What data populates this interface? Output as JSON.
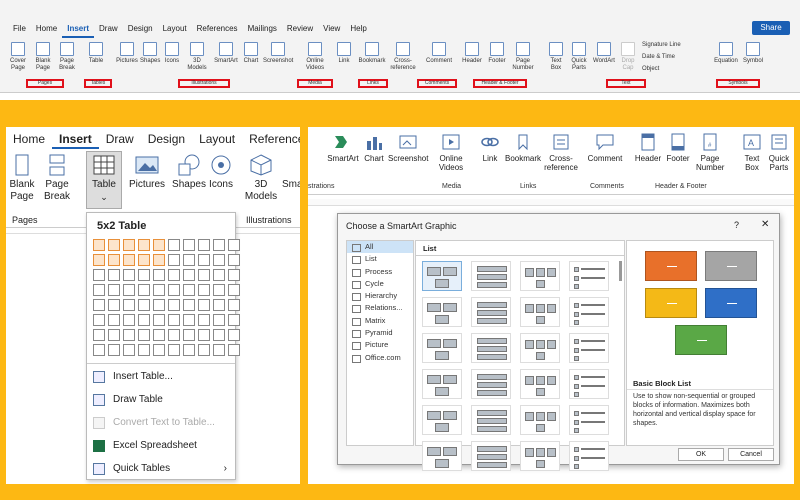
{
  "top_ribbon": {
    "tabs": [
      "File",
      "Home",
      "Insert",
      "Draw",
      "Design",
      "Layout",
      "References",
      "Mailings",
      "Review",
      "View",
      "Help"
    ],
    "share_label": "Share",
    "buttons": [
      {
        "label": "Cover Page"
      },
      {
        "label": "Blank Page"
      },
      {
        "label": "Page Break"
      },
      {
        "label": "Table"
      },
      {
        "label": "Pictures"
      },
      {
        "label": "Shapes"
      },
      {
        "label": "Icons"
      },
      {
        "label": "3D Models"
      },
      {
        "label": "SmartArt"
      },
      {
        "label": "Chart"
      },
      {
        "label": "Screenshot"
      },
      {
        "label": "Online Videos"
      },
      {
        "label": "Link"
      },
      {
        "label": "Bookmark"
      },
      {
        "label": "Cross-reference"
      },
      {
        "label": "Comment"
      },
      {
        "label": "Header"
      },
      {
        "label": "Footer"
      },
      {
        "label": "Page Number"
      },
      {
        "label": "Text Box"
      },
      {
        "label": "Quick Parts"
      },
      {
        "label": "WordArt"
      },
      {
        "label": "Drop Cap"
      },
      {
        "label": "Signature Line"
      },
      {
        "label": "Date & Time"
      },
      {
        "label": "Object"
      },
      {
        "label": "Equation"
      },
      {
        "label": "Symbol"
      }
    ],
    "groups": [
      "Pages",
      "Tables",
      "Illustrations",
      "Media",
      "Links",
      "Comments",
      "Header & Footer",
      "Text",
      "Symbols"
    ]
  },
  "left_panel": {
    "tabs": [
      "Home",
      "Insert",
      "Draw",
      "Design",
      "Layout",
      "References"
    ],
    "buttons": [
      {
        "label": "Blank Page"
      },
      {
        "label": "Page Break"
      },
      {
        "label": "Table"
      },
      {
        "label": "Pictures"
      },
      {
        "label": "Shapes"
      },
      {
        "label": "Icons"
      },
      {
        "label": "3D Models"
      },
      {
        "label": "Smar"
      }
    ],
    "group_pages": "Pages",
    "group_illustrations": "Illustrations",
    "dropdown": {
      "title": "5x2 Table",
      "grid_cols": 10,
      "grid_rows": 8,
      "highlight_cols": 5,
      "highlight_rows": 2,
      "menu": [
        {
          "label": "Insert Table...",
          "disabled": false
        },
        {
          "label": "Draw Table",
          "disabled": false
        },
        {
          "label": "Convert Text to Table...",
          "disabled": true
        },
        {
          "label": "Excel Spreadsheet",
          "disabled": false
        },
        {
          "label": "Quick Tables",
          "disabled": false
        }
      ]
    }
  },
  "right_panel": {
    "buttons": [
      {
        "label": "SmartArt"
      },
      {
        "label": "Chart"
      },
      {
        "label": "Screenshot"
      },
      {
        "label": "Online Videos"
      },
      {
        "label": "Link"
      },
      {
        "label": "Bookmark"
      },
      {
        "label": "Cross-reference"
      },
      {
        "label": "Comment"
      },
      {
        "label": "Header"
      },
      {
        "label": "Footer"
      },
      {
        "label": "Page Number"
      },
      {
        "label": "Text Box"
      },
      {
        "label": "Quick Parts"
      }
    ],
    "groups": [
      "strations",
      "Media",
      "Links",
      "Comments",
      "Header & Footer"
    ],
    "dialog": {
      "title": "Choose a SmartArt Graphic",
      "help": "?",
      "close": "✕",
      "categories": [
        "All",
        "List",
        "Process",
        "Cycle",
        "Hierarchy",
        "Relations...",
        "Matrix",
        "Pyramid",
        "Picture",
        "Office.com"
      ],
      "selected_category": "All",
      "list_title": "List",
      "preview_name": "Basic Block List",
      "preview_desc": "Use to show non-sequential or grouped blocks of information. Maximizes both horizontal and vertical display space for shapes.",
      "ok": "OK",
      "cancel": "Cancel",
      "block_colors": [
        "#e8702a",
        "#a5a5a5",
        "#f4b917",
        "#2f6fc7",
        "#5aa846"
      ]
    }
  }
}
